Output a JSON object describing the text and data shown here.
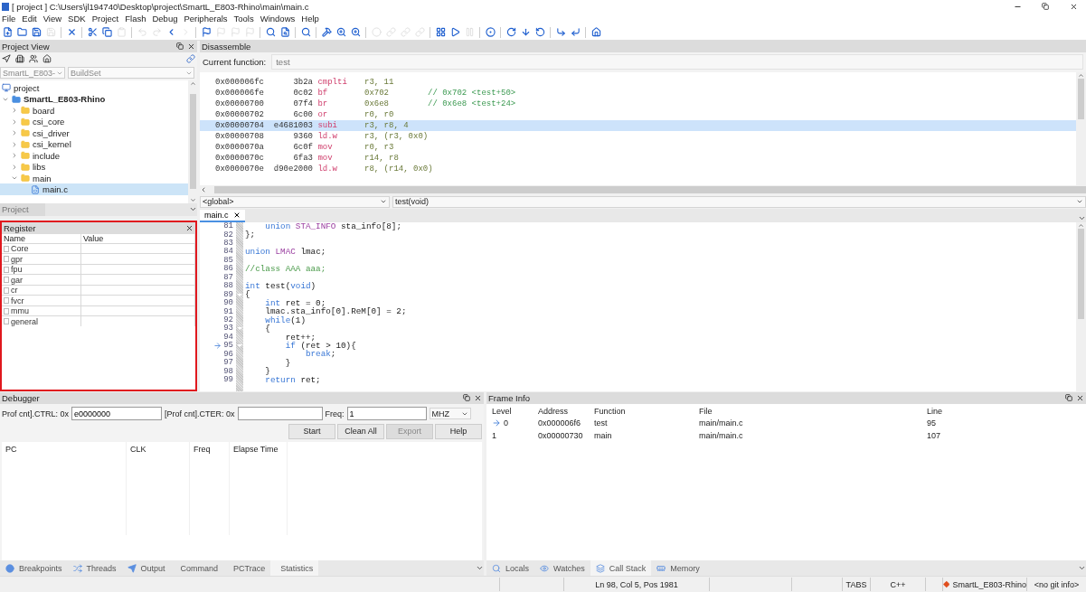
{
  "window": {
    "title": "[ project ] C:\\Users\\jl194740\\Desktop\\project\\SmartL_E803-Rhino\\main\\main.c"
  },
  "menu": [
    "File",
    "Edit",
    "View",
    "SDK",
    "Project",
    "Flash",
    "Debug",
    "Peripherals",
    "Tools",
    "Windows",
    "Help"
  ],
  "toolbar": [
    {
      "kind": "new",
      "disabled": false
    },
    {
      "kind": "open",
      "disabled": false
    },
    {
      "kind": "saveall",
      "disabled": false
    },
    {
      "kind": "save",
      "disabled": true
    },
    {
      "kind": "sep"
    },
    {
      "kind": "close",
      "disabled": false
    },
    {
      "kind": "sep"
    },
    {
      "kind": "cut",
      "disabled": false
    },
    {
      "kind": "copy",
      "disabled": false
    },
    {
      "kind": "paste",
      "disabled": true
    },
    {
      "kind": "sep"
    },
    {
      "kind": "undo",
      "disabled": true
    },
    {
      "kind": "redo",
      "disabled": true
    },
    {
      "kind": "back",
      "disabled": false
    },
    {
      "kind": "forward",
      "disabled": true
    },
    {
      "kind": "sep"
    },
    {
      "kind": "flag",
      "disabled": false
    },
    {
      "kind": "flag",
      "disabled": true
    },
    {
      "kind": "flag",
      "disabled": true
    },
    {
      "kind": "flag",
      "disabled": true
    },
    {
      "kind": "sep"
    },
    {
      "kind": "search",
      "disabled": false
    },
    {
      "kind": "find",
      "disabled": false
    },
    {
      "kind": "sep"
    },
    {
      "kind": "search",
      "disabled": false
    },
    {
      "kind": "sep"
    },
    {
      "kind": "build",
      "disabled": false
    },
    {
      "kind": "zoom",
      "disabled": false
    },
    {
      "kind": "zoom",
      "disabled": false
    },
    {
      "kind": "sep"
    },
    {
      "kind": "dot",
      "disabled": true
    },
    {
      "kind": "link",
      "disabled": true
    },
    {
      "kind": "link",
      "disabled": true
    },
    {
      "kind": "link",
      "disabled": true
    },
    {
      "kind": "sep"
    },
    {
      "kind": "grid",
      "disabled": false
    },
    {
      "kind": "run",
      "disabled": false
    },
    {
      "kind": "pause",
      "disabled": true
    },
    {
      "kind": "sep"
    },
    {
      "kind": "target",
      "disabled": false
    },
    {
      "kind": "sep"
    },
    {
      "kind": "stepover",
      "disabled": false
    },
    {
      "kind": "stepinto",
      "disabled": false
    },
    {
      "kind": "stepout",
      "disabled": false
    },
    {
      "kind": "sep"
    },
    {
      "kind": "stepin",
      "disabled": false
    },
    {
      "kind": "stepback",
      "disabled": false
    },
    {
      "kind": "sep"
    },
    {
      "kind": "home",
      "disabled": false
    }
  ],
  "project_view": {
    "title": "Project View",
    "target_select": "SmartL_E803-",
    "buildset_select": "BuildSet",
    "tab": "Project",
    "tree": [
      {
        "label": "project",
        "kind": "root",
        "selected": false,
        "children": [
          {
            "label": "SmartL_E803-Rhino",
            "kind": "project",
            "expanded": true,
            "selected": false,
            "children": [
              {
                "label": "board",
                "kind": "folder",
                "expanded": false,
                "selected": false
              },
              {
                "label": "csi_core",
                "kind": "folder",
                "expanded": false,
                "selected": false
              },
              {
                "label": "csi_driver",
                "kind": "folder",
                "expanded": false,
                "selected": false
              },
              {
                "label": "csi_kernel",
                "kind": "folder",
                "expanded": false,
                "selected": false
              },
              {
                "label": "include",
                "kind": "folder",
                "expanded": false,
                "selected": false
              },
              {
                "label": "libs",
                "kind": "folder",
                "expanded": false,
                "selected": false
              },
              {
                "label": "main",
                "kind": "folder",
                "expanded": true,
                "selected": false,
                "children": [
                  {
                    "label": "main.c",
                    "kind": "file",
                    "selected": true
                  }
                ]
              }
            ]
          }
        ]
      }
    ]
  },
  "register": {
    "title": "Register",
    "columns": [
      "Name",
      "Value"
    ],
    "rows": [
      "Core",
      "gpr",
      "fpu",
      "gar",
      "cr",
      "fvcr",
      "mmu",
      "general"
    ]
  },
  "disassemble": {
    "title": "Disassemble",
    "current_function_label": "Current function:",
    "current_function": "test",
    "rows": [
      {
        "addr": "0x000006fc",
        "op": "3b2a",
        "mn": "cmplti",
        "args": "r3, 11",
        "selected": false
      },
      {
        "addr": "0x000006fe",
        "op": "0c02",
        "mn": "bf",
        "args": "0x702",
        "comment": "// 0x702 <test+50>",
        "selected": false
      },
      {
        "addr": "0x00000700",
        "op": "07f4",
        "mn": "br",
        "args": "0x6e8",
        "comment": "// 0x6e8 <test+24>",
        "selected": false
      },
      {
        "addr": "0x00000702",
        "op": "6c00",
        "mn": "or",
        "args": "r0, r0",
        "selected": false
      },
      {
        "addr": "0x00000704",
        "op": "e4681003",
        "mn": "subi",
        "args": "r3, r8, 4",
        "selected": true
      },
      {
        "addr": "0x00000708",
        "op": "9360",
        "mn": "ld.w",
        "args": "r3, (r3, 0x0)",
        "selected": false
      },
      {
        "addr": "0x0000070a",
        "op": "6c0f",
        "mn": "mov",
        "args": "r0, r3",
        "selected": false
      },
      {
        "addr": "0x0000070c",
        "op": "6fa3",
        "mn": "mov",
        "args": "r14, r8",
        "selected": false
      },
      {
        "addr": "0x0000070e",
        "op": "d90e2000",
        "mn": "ld.w",
        "args": "r8, (r14, 0x0)",
        "selected": false
      }
    ]
  },
  "scope_select": "<global>",
  "function_select": "test(void)",
  "editor": {
    "tabs": [
      {
        "label": "main.c",
        "selected": true
      }
    ],
    "lines": [
      {
        "n": "81",
        "fold": false,
        "current": false,
        "tokens": [
          {
            "kind": "keyword",
            "t": "    union "
          },
          {
            "kind": "type",
            "t": "STA_INFO"
          },
          {
            "kind": "plain",
            "t": " sta_info[8];"
          }
        ]
      },
      {
        "n": "82",
        "fold": false,
        "current": false,
        "tokens": [
          {
            "kind": "plain",
            "t": "};"
          }
        ]
      },
      {
        "n": "83",
        "fold": false,
        "current": false
      },
      {
        "n": "84",
        "fold": false,
        "current": false,
        "tokens": [
          {
            "kind": "keyword",
            "t": "union "
          },
          {
            "kind": "type",
            "t": "LMAC"
          },
          {
            "kind": "plain",
            "t": " lmac;"
          }
        ]
      },
      {
        "n": "85",
        "fold": false,
        "current": false
      },
      {
        "n": "86",
        "fold": false,
        "current": false,
        "tokens": [
          {
            "kind": "comment",
            "t": "//class AAA aaa;"
          }
        ]
      },
      {
        "n": "87",
        "fold": false,
        "current": false
      },
      {
        "n": "88",
        "fold": false,
        "current": false,
        "tokens": [
          {
            "kind": "keyword",
            "t": "int"
          },
          {
            "kind": "plain",
            "t": " test("
          },
          {
            "kind": "keyword",
            "t": "void"
          },
          {
            "kind": "plain",
            "t": ")"
          }
        ]
      },
      {
        "n": "89",
        "fold": true,
        "current": false,
        "tokens": [
          {
            "kind": "plain",
            "t": "{"
          }
        ]
      },
      {
        "n": "90",
        "fold": false,
        "current": false,
        "tokens": [
          {
            "kind": "keyword",
            "t": "    int"
          },
          {
            "kind": "plain",
            "t": " ret = 0;"
          }
        ]
      },
      {
        "n": "91",
        "fold": false,
        "current": false,
        "tokens": [
          {
            "kind": "plain",
            "t": "    lmac.sta_info[0].ReM[0] = 2;"
          }
        ]
      },
      {
        "n": "92",
        "fold": false,
        "current": false,
        "tokens": [
          {
            "kind": "keyword",
            "t": "    while"
          },
          {
            "kind": "plain",
            "t": "(1)"
          }
        ]
      },
      {
        "n": "93",
        "fold": true,
        "current": false,
        "tokens": [
          {
            "kind": "plain",
            "t": "    {"
          }
        ]
      },
      {
        "n": "94",
        "fold": false,
        "current": false,
        "tokens": [
          {
            "kind": "plain",
            "t": "        ret++;"
          }
        ]
      },
      {
        "n": "95",
        "fold": true,
        "current": true,
        "tokens": [
          {
            "kind": "keyword",
            "t": "        if"
          },
          {
            "kind": "plain",
            "t": " (ret > 10){"
          }
        ]
      },
      {
        "n": "96",
        "fold": false,
        "current": false,
        "tokens": [
          {
            "kind": "keyword",
            "t": "            break"
          },
          {
            "kind": "plain",
            "t": ";"
          }
        ]
      },
      {
        "n": "97",
        "fold": false,
        "current": false,
        "tokens": [
          {
            "kind": "plain",
            "t": "        }"
          }
        ]
      },
      {
        "n": "98",
        "fold": false,
        "current": false,
        "tokens": [
          {
            "kind": "plain",
            "t": "    }"
          }
        ]
      },
      {
        "n": "99",
        "fold": false,
        "current": false,
        "tokens": [
          {
            "kind": "keyword",
            "t": "    return"
          },
          {
            "kind": "plain",
            "t": " ret;"
          }
        ]
      }
    ]
  },
  "debugger": {
    "title": "Debugger",
    "fields": [
      {
        "label": "Prof cnt].CTRL: 0x",
        "value": "e0000000"
      },
      {
        "label": "[Prof cnt].CTER: 0x"
      },
      {
        "label": "Freq:",
        "value": "1"
      }
    ],
    "unit_select": "MHZ",
    "buttons": [
      {
        "label": "Start",
        "disabled": false
      },
      {
        "label": "Clean All",
        "disabled": false
      },
      {
        "label": "Export",
        "disabled": true
      },
      {
        "label": "Help",
        "disabled": false
      }
    ],
    "columns": [
      "PC",
      "CLK",
      "Freq",
      "Elapse Time"
    ],
    "tabs": [
      {
        "label": "Breakpoints",
        "selected": false
      },
      {
        "label": "Threads",
        "selected": false
      },
      {
        "label": "Output",
        "selected": false
      },
      {
        "label": "Command",
        "selected": false
      },
      {
        "label": "PCTrace",
        "selected": false
      },
      {
        "label": "Statistics",
        "selected": true
      }
    ]
  },
  "frame_info": {
    "title": "Frame Info",
    "columns": [
      "Level",
      "Address",
      "Function",
      "File",
      "Line"
    ],
    "rows": [
      {
        "level": "0",
        "address": "0x000006f6",
        "function": "test",
        "file": "main/main.c",
        "line": "95",
        "current": true
      },
      {
        "level": "1",
        "address": "0x00000730",
        "function": "main",
        "file": "main/main.c",
        "line": "107",
        "current": false
      }
    ],
    "tabs": [
      {
        "label": "Locals",
        "selected": false
      },
      {
        "label": "Watches",
        "selected": false
      },
      {
        "label": "Call Stack",
        "selected": true
      },
      {
        "label": "Memory",
        "selected": false
      }
    ]
  },
  "status_bar": {
    "position": "Ln 98, Col 5, Pos 1981",
    "indent": "TABS",
    "language": "C++",
    "project": "SmartL_E803-Rhino",
    "git": "<no git info>"
  }
}
